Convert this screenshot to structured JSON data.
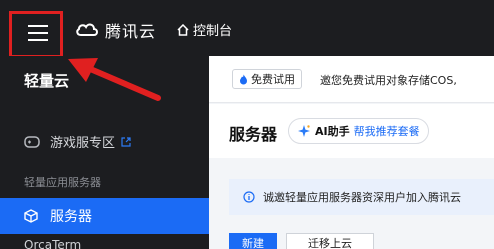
{
  "topbar": {
    "logo_text": "腾讯云",
    "console_label": "控制台"
  },
  "sidebar": {
    "brand": "轻量云",
    "game_zone_label": "游戏服专区",
    "section_label": "轻量应用服务器",
    "active_item_label": "服务器",
    "next_item_label": "OrcaTerm"
  },
  "promo": {
    "tag_label": "免费试用",
    "text": "邀您免费试用对象存储COS,"
  },
  "main": {
    "title": "服务器",
    "ai_name": "AI助手",
    "ai_link": "帮我推荐套餐",
    "notice_text": "诚邀轻量应用服务器资深用户加入腾讯云",
    "new_button": "新建",
    "migrate_button": "迁移上云"
  },
  "colors": {
    "accent": "#1b6bf5",
    "topbar_bg": "#1c1d20",
    "highlight_red": "#e02020"
  }
}
